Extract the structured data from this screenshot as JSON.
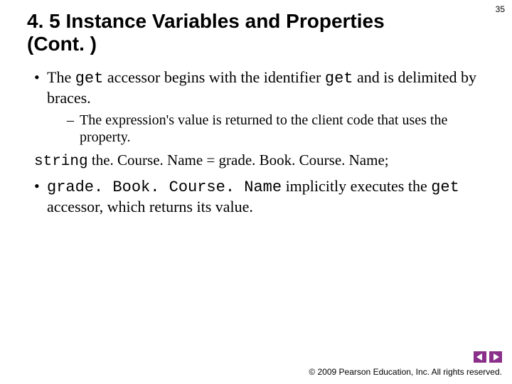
{
  "page_number": "35",
  "title": "4. 5  Instance Variables and Properties (Cont. )",
  "bullets": {
    "b1_pre": "The ",
    "b1_code1": "get",
    "b1_mid": " accessor begins with the identifier ",
    "b1_code2": "get",
    "b1_post": " and is delimited by braces.",
    "b1_sub": "The expression's value is returned to the client code that uses the property.",
    "code_kw": "string",
    "code_rest": " the. Course. Name = grade. Book. Course. Name;",
    "b2_code1": "grade. Book. Course. Name",
    "b2_mid": " implicitly executes the ",
    "b2_code2": "get",
    "b2_post": " accessor, which returns its value."
  },
  "footer": "© 2009 Pearson Education, Inc.  All rights reserved.",
  "nav": {
    "prev": "previous slide",
    "next": "next slide"
  }
}
